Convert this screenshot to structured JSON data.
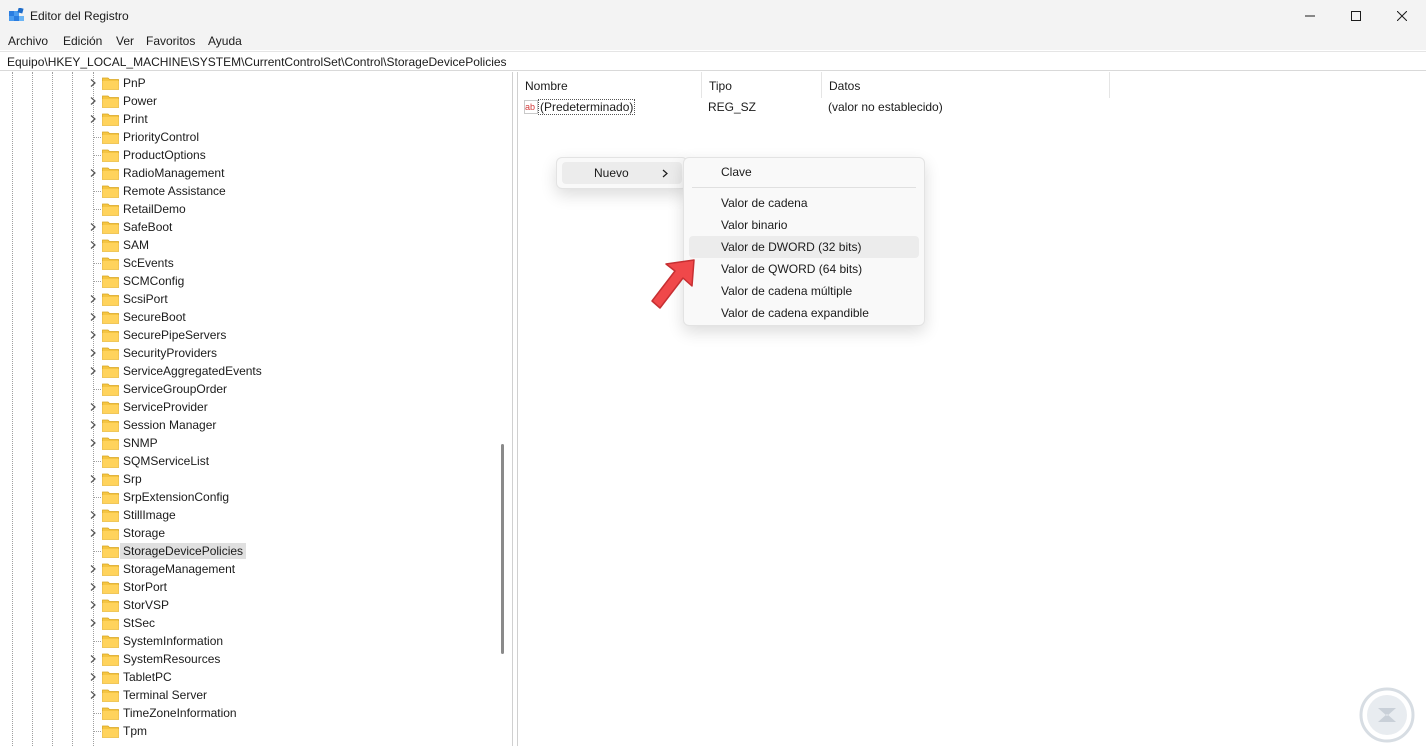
{
  "window": {
    "title": "Editor del Registro",
    "controls": [
      "minimize-icon",
      "maximize-icon",
      "close-icon"
    ]
  },
  "menu": {
    "items": [
      "Archivo",
      "Edición",
      "Ver",
      "Favoritos",
      "Ayuda"
    ]
  },
  "address": {
    "path": "Equipo\\HKEY_LOCAL_MACHINE\\SYSTEM\\CurrentControlSet\\Control\\StorageDevicePolicies"
  },
  "tree": {
    "items": [
      {
        "label": "PnP",
        "expandable": true
      },
      {
        "label": "Power",
        "expandable": true
      },
      {
        "label": "Print",
        "expandable": true
      },
      {
        "label": "PriorityControl",
        "expandable": false
      },
      {
        "label": "ProductOptions",
        "expandable": false
      },
      {
        "label": "RadioManagement",
        "expandable": true
      },
      {
        "label": "Remote Assistance",
        "expandable": false
      },
      {
        "label": "RetailDemo",
        "expandable": false
      },
      {
        "label": "SafeBoot",
        "expandable": true
      },
      {
        "label": "SAM",
        "expandable": true
      },
      {
        "label": "ScEvents",
        "expandable": false
      },
      {
        "label": "SCMConfig",
        "expandable": false
      },
      {
        "label": "ScsiPort",
        "expandable": true
      },
      {
        "label": "SecureBoot",
        "expandable": true
      },
      {
        "label": "SecurePipeServers",
        "expandable": true
      },
      {
        "label": "SecurityProviders",
        "expandable": true
      },
      {
        "label": "ServiceAggregatedEvents",
        "expandable": true
      },
      {
        "label": "ServiceGroupOrder",
        "expandable": false
      },
      {
        "label": "ServiceProvider",
        "expandable": true
      },
      {
        "label": "Session Manager",
        "expandable": true
      },
      {
        "label": "SNMP",
        "expandable": true
      },
      {
        "label": "SQMServiceList",
        "expandable": false
      },
      {
        "label": "Srp",
        "expandable": true
      },
      {
        "label": "SrpExtensionConfig",
        "expandable": false
      },
      {
        "label": "StillImage",
        "expandable": true
      },
      {
        "label": "Storage",
        "expandable": true
      },
      {
        "label": "StorageDevicePolicies",
        "expandable": false,
        "selected": true
      },
      {
        "label": "StorageManagement",
        "expandable": true
      },
      {
        "label": "StorPort",
        "expandable": true
      },
      {
        "label": "StorVSP",
        "expandable": true
      },
      {
        "label": "StSec",
        "expandable": true
      },
      {
        "label": "SystemInformation",
        "expandable": false
      },
      {
        "label": "SystemResources",
        "expandable": true
      },
      {
        "label": "TabletPC",
        "expandable": true
      },
      {
        "label": "Terminal Server",
        "expandable": true
      },
      {
        "label": "TimeZoneInformation",
        "expandable": false
      },
      {
        "label": "Tpm",
        "expandable": false
      }
    ]
  },
  "list": {
    "columns": [
      "Nombre",
      "Tipo",
      "Datos"
    ],
    "rows": [
      {
        "icon": "string-value-icon",
        "name": "(Predeterminado)",
        "type": "REG_SZ",
        "data": "(valor no establecido)"
      }
    ]
  },
  "context_menu": {
    "item": "Nuevo",
    "submenu": {
      "items": [
        "Clave",
        "Valor de cadena",
        "Valor binario",
        "Valor de DWORD (32 bits)",
        "Valor de QWORD (64 bits)",
        "Valor de cadena múltiple",
        "Valor de cadena expandible"
      ],
      "hovered": "Valor de DWORD (32 bits)"
    }
  },
  "colors": {
    "folder": "#f5c542",
    "arrow": "#f0484a",
    "selection": "#e0e0e0"
  }
}
